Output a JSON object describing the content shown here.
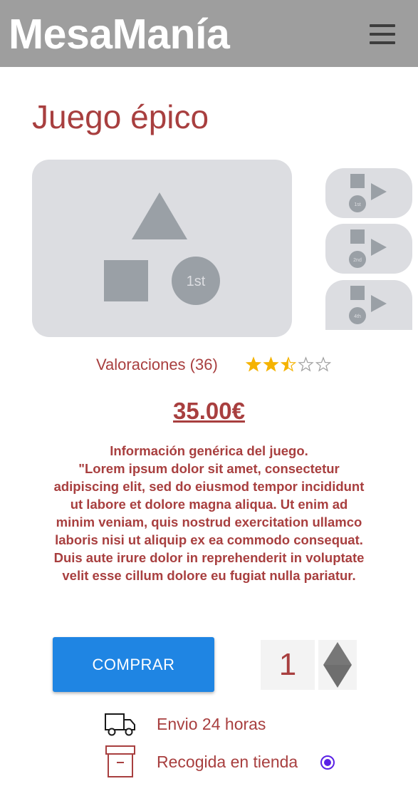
{
  "header": {
    "brand": "MesaManía",
    "menu_icon": "hamburger-menu-icon",
    "bg_color": "#9e9e9e"
  },
  "product": {
    "title": "Juego épico",
    "main_image": {
      "badge": "1st"
    },
    "thumbnails": [
      {
        "badge": "1st"
      },
      {
        "badge": "2nd"
      },
      {
        "badge": "4th"
      }
    ],
    "ratings_label": "Valoraciones (36)",
    "rating_value": 2.5,
    "rating_max": 5,
    "price": "35.00€",
    "description_title": "Información genérica del juego.",
    "description_body": "\"Lorem ipsum dolor sit amet, consectetur adipiscing elit, sed do eiusmod tempor incididunt ut labore et dolore magna aliqua. Ut enim ad minim veniam, quis nostrud exercitation ullamco laboris nisi ut aliquip ex ea commodo consequat. Duis aute irure dolor in reprehenderit in voluptate velit esse cillum dolore eu fugiat nulla pariatur."
  },
  "purchase": {
    "buy_label": "COMPRAR",
    "quantity": "1"
  },
  "delivery": {
    "shipping_label": "Envio 24 horas",
    "pickup_label": "Recogida en tienda",
    "pickup_selected": true
  },
  "colors": {
    "accent": "#a83f3f",
    "button": "#1f85e3",
    "star": "#f5b301",
    "radio": "#5a21e6",
    "placeholder": "#dcdde1",
    "shape": "#9aa0a6"
  }
}
